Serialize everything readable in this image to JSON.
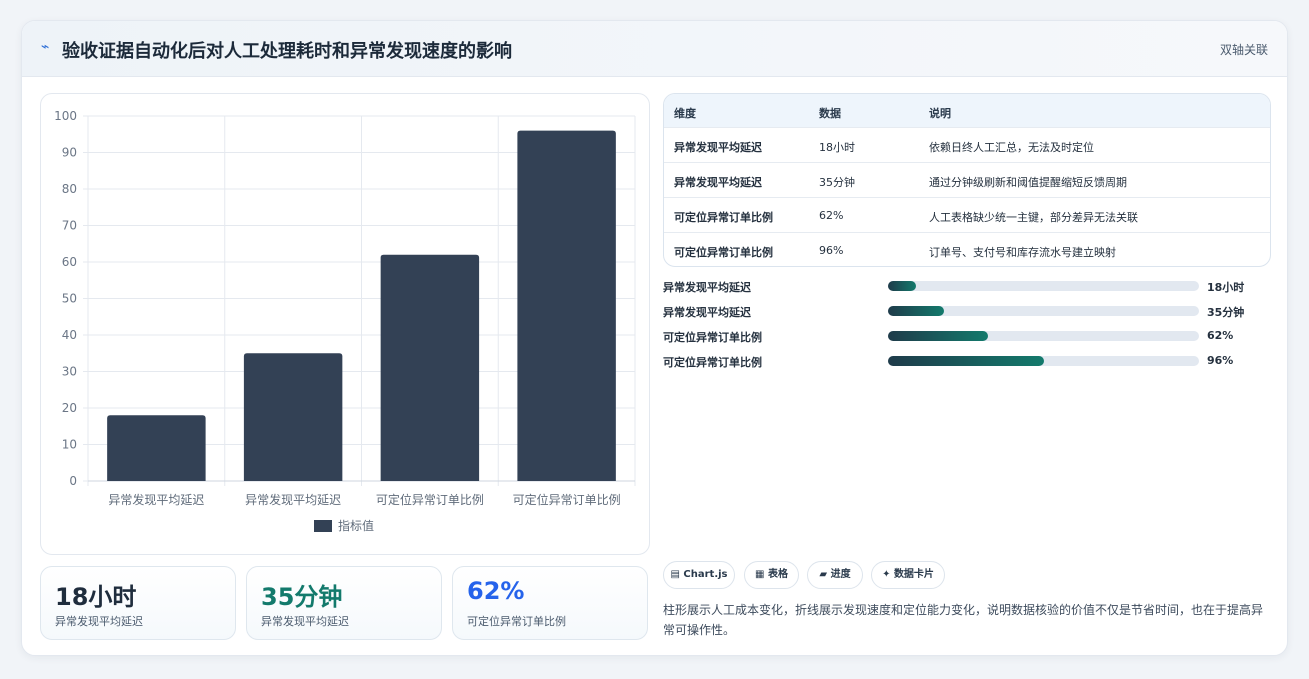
{
  "header": {
    "title": "验收证据自动化后对人工处理耗时和异常发现速度的影响",
    "tag": "双轴关联",
    "icon": "bolt-icon"
  },
  "chart_data": {
    "type": "bar",
    "categories": [
      "异常发现平均延迟",
      "异常发现平均延迟",
      "可定位异常订单比例",
      "可定位异常订单比例"
    ],
    "series": [
      {
        "name": "指标值",
        "values": [
          18,
          35,
          62,
          96
        ],
        "color": "#334155"
      }
    ],
    "ylim": [
      0,
      100
    ],
    "yticks": [
      0,
      10,
      20,
      30,
      40,
      50,
      60,
      70,
      80,
      90,
      100
    ],
    "legend": "bottom",
    "grid": true
  },
  "stats": [
    {
      "value": "18小时",
      "label": "异常发现平均延迟",
      "color": "#1f2d3d"
    },
    {
      "value": "35分钟",
      "label": "异常发现平均延迟",
      "color": "#137a6c"
    },
    {
      "value": "62%",
      "label": "可定位异常订单比例",
      "color": "#2563eb"
    }
  ],
  "table": {
    "headers": [
      "维度",
      "数据",
      "说明"
    ],
    "rows": [
      [
        "异常发现平均延迟",
        "18小时",
        "依赖日终人工汇总，无法及时定位"
      ],
      [
        "异常发现平均延迟",
        "35分钟",
        "通过分钟级刷新和阈值提醒缩短反馈周期"
      ],
      [
        "可定位异常订单比例",
        "62%",
        "人工表格缺少统一主键，部分差异无法关联"
      ],
      [
        "可定位异常订单比例",
        "96%",
        "订单号、支付号和库存流水号建立映射"
      ]
    ]
  },
  "progress": [
    {
      "label": "异常发现平均延迟",
      "value_text": "18小时",
      "fraction": 0.09
    },
    {
      "label": "异常发现平均延迟",
      "value_text": "35分钟",
      "fraction": 0.18
    },
    {
      "label": "可定位异常订单比例",
      "value_text": "62%",
      "fraction": 0.32
    },
    {
      "label": "可定位异常订单比例",
      "value_text": "96%",
      "fraction": 0.5
    }
  ],
  "chips": [
    {
      "label": "Chart.js",
      "glyph": "▤"
    },
    {
      "label": "表格",
      "glyph": "▦"
    },
    {
      "label": "进度",
      "glyph": "▰"
    },
    {
      "label": "数据卡片",
      "glyph": "✦"
    }
  ],
  "note": "柱形展示人工成本变化，折线展示发现速度和定位能力变化，说明数据核验的价值不仅是节省时间，也在于提高异常可操作性。"
}
